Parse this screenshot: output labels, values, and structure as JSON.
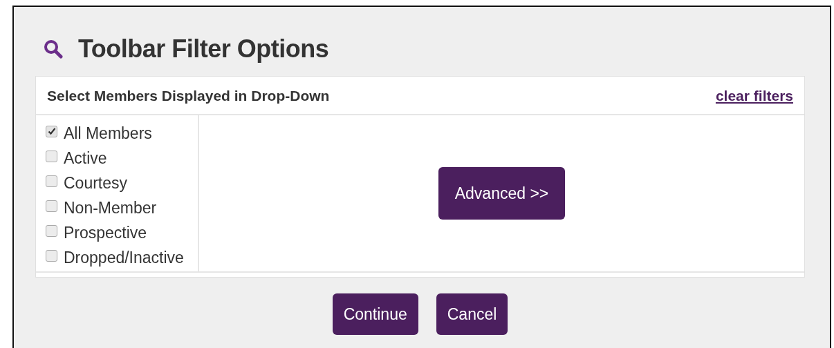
{
  "dialog": {
    "title": "Toolbar Filter Options"
  },
  "panel": {
    "heading": "Select Members Displayed in Drop-Down",
    "clear_link": "clear filters"
  },
  "members": [
    {
      "label": "All Members",
      "checked": true
    },
    {
      "label": "Active",
      "checked": false
    },
    {
      "label": "Courtesy",
      "checked": false
    },
    {
      "label": "Non-Member",
      "checked": false
    },
    {
      "label": "Prospective",
      "checked": false
    },
    {
      "label": "Dropped/Inactive",
      "checked": false
    }
  ],
  "advanced_button": "Advanced >>",
  "buttons": [
    "Continue",
    "Cancel"
  ]
}
